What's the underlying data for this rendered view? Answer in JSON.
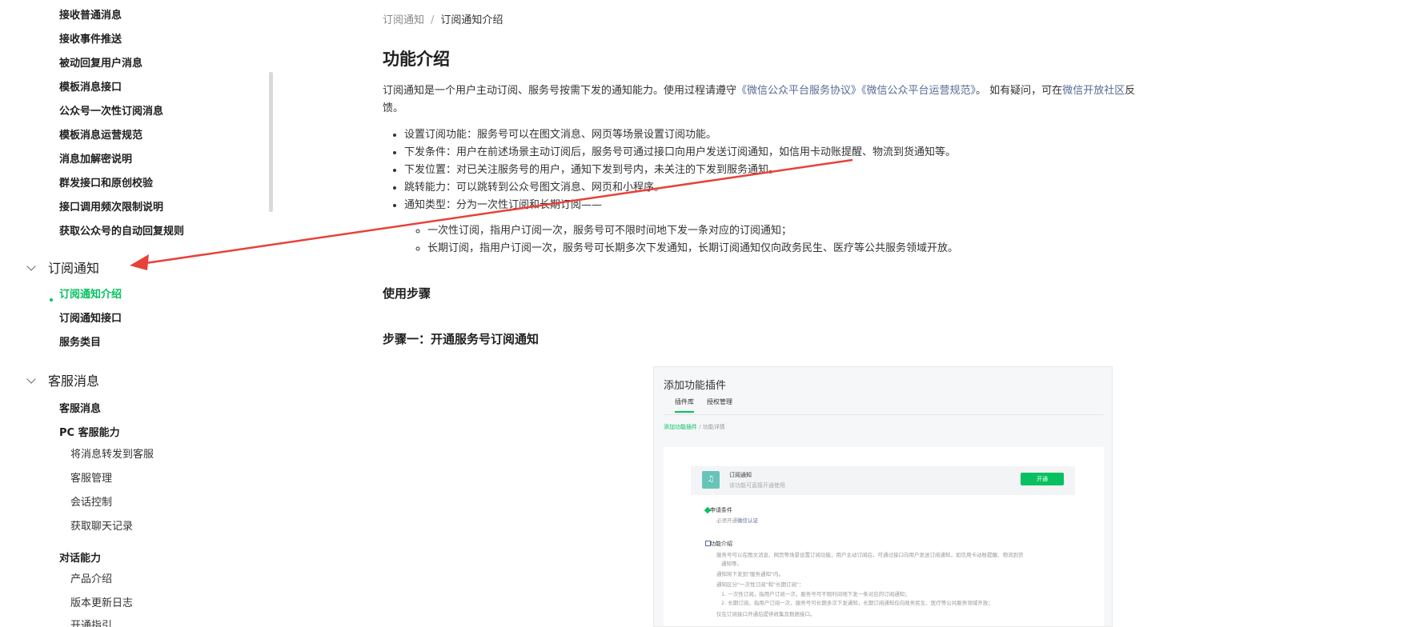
{
  "sidebar": {
    "items_top": [
      "接收普通消息",
      "接收事件推送",
      "被动回复用户消息",
      "模板消息接口",
      "公众号一次性订阅消息",
      "模板消息运营规范",
      "消息加解密说明",
      "群发接口和原创校验",
      "接口调用频次限制说明",
      "获取公众号的自动回复规则"
    ],
    "group_subscribe": "订阅通知",
    "subscribe_items": [
      "订阅通知介绍",
      "订阅通知接口",
      "服务类目"
    ],
    "group_kf": "客服消息",
    "kf_items": [
      "客服消息",
      "PC 客服能力"
    ],
    "pc_sub_items": [
      "将消息转发到客服",
      "客服管理",
      "会话控制",
      "获取聊天记录"
    ],
    "dialog_title": "对话能力",
    "dialog_sub_items": [
      "产品介绍",
      "版本更新日志",
      "开通指引"
    ]
  },
  "breadcrumb": {
    "parent": "订阅通知",
    "sep": "/",
    "current": "订阅通知介绍"
  },
  "page_title": "功能介绍",
  "intro": {
    "text1": "订阅通知是一个用户主动订阅、服务号按需下发的通知能力。使用过程请遵守",
    "link1": "《微信公众平台服务协议》",
    "link2": "《微信公众平台运营规范》",
    "text2": "。 如有疑问，可在",
    "link3": "微信开放社区",
    "text3": "反馈。"
  },
  "features": [
    "设置订阅功能：服务号可以在图文消息、网页等场景设置订阅功能。",
    "下发条件：用户在前述场景主动订阅后，服务号可通过接口向用户发送订阅通知，如信用卡动账提醒、物流到货通知等。",
    "下发位置：对已关注服务号的用户，通知下发到号内，未关注的下发到服务通知。",
    "跳转能力：可以跳转到公众号图文消息、网页和小程序。",
    "通知类型：分为一次性订阅和长期订阅——"
  ],
  "subfeatures": [
    "一次性订阅，指用户订阅一次，服务号可不限时间地下发一条对应的订阅通知；",
    "长期订阅，指用户订阅一次，服务号可长期多次下发通知，长期订阅通知仅向政务民生、医疗等公共服务领域开放。"
  ],
  "steps_title": "使用步骤",
  "step1_title": "步骤一：开通服务号订阅通知",
  "screenshot": {
    "title": "添加功能插件",
    "tab1": "插件库",
    "tab2": "授权管理",
    "crumb_link": "添加功能插件",
    "crumb_rest": " / 功能详情",
    "plugin_name": "订阅通知",
    "plugin_desc": "该功能可直接开通使用",
    "open_btn": "开通",
    "req_title": "申请条件",
    "req_line1": "必须开通",
    "req_link": "微信认证",
    "intro_title": "功能介绍",
    "intro_lines": [
      "服务号可以在图文消息、网页等场景设置订阅功能，用户主动订阅后，可通过接口向用户发送订阅通知，如信用卡动账提醒、物流到货",
      "通知等。",
      "通知将下发到\"服务通知\"内。",
      "通知区分\"一次性订阅\"和\"长期订阅\"：",
      "1. 一次性订阅，指用户订阅一次，服务号可不限时间地下发一条对应的订阅通知；",
      "2. 长期订阅，指用户订阅一次，服务号可长期多次下发通知，长期订阅通知仅向政务民生、医疗等公共服务领域开放；",
      "仅在订阅接口开通后提供收集及数据接口。"
    ]
  },
  "colors": {
    "accent": "#07c160",
    "link": "#576b95",
    "arrow": "#e8413a"
  }
}
